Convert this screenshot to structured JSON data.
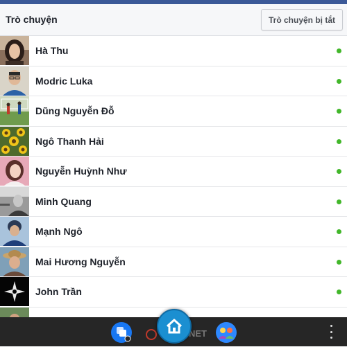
{
  "header": {
    "title": "Trò chuyện",
    "turn_off_button": "Trò chuyện bị tắt"
  },
  "contacts": [
    {
      "name": "Hà Thu",
      "online": true,
      "avatar": "avatar-woman-dark-hair"
    },
    {
      "name": "Modric Luka",
      "online": true,
      "avatar": "avatar-man-glasses"
    },
    {
      "name": "Dũng Nguyễn Đỗ",
      "online": true,
      "avatar": "avatar-soccer-field"
    },
    {
      "name": "Ngô Thanh Hải",
      "online": true,
      "avatar": "avatar-sunflowers"
    },
    {
      "name": "Nguyễn Huỳnh Như",
      "online": true,
      "avatar": "avatar-woman-pink"
    },
    {
      "name": "Minh Quang",
      "online": true,
      "avatar": "avatar-man-bw"
    },
    {
      "name": "Mạnh Ngô",
      "online": true,
      "avatar": "avatar-man-helmet"
    },
    {
      "name": "Mai Hương Nguyễn",
      "online": true,
      "avatar": "avatar-woman-hat"
    },
    {
      "name": "John Trần",
      "online": true,
      "avatar": "avatar-logo-black"
    }
  ],
  "bottom_bar": {
    "watermark": "NET",
    "icons": [
      "messages-icon",
      "home-icon",
      "groups-icon",
      "overflow-menu-icon"
    ]
  },
  "colors": {
    "brand": "#3b5998",
    "online": "#42b72a",
    "bottom_bar": "#262626",
    "home_button": "#1b8fd1"
  }
}
